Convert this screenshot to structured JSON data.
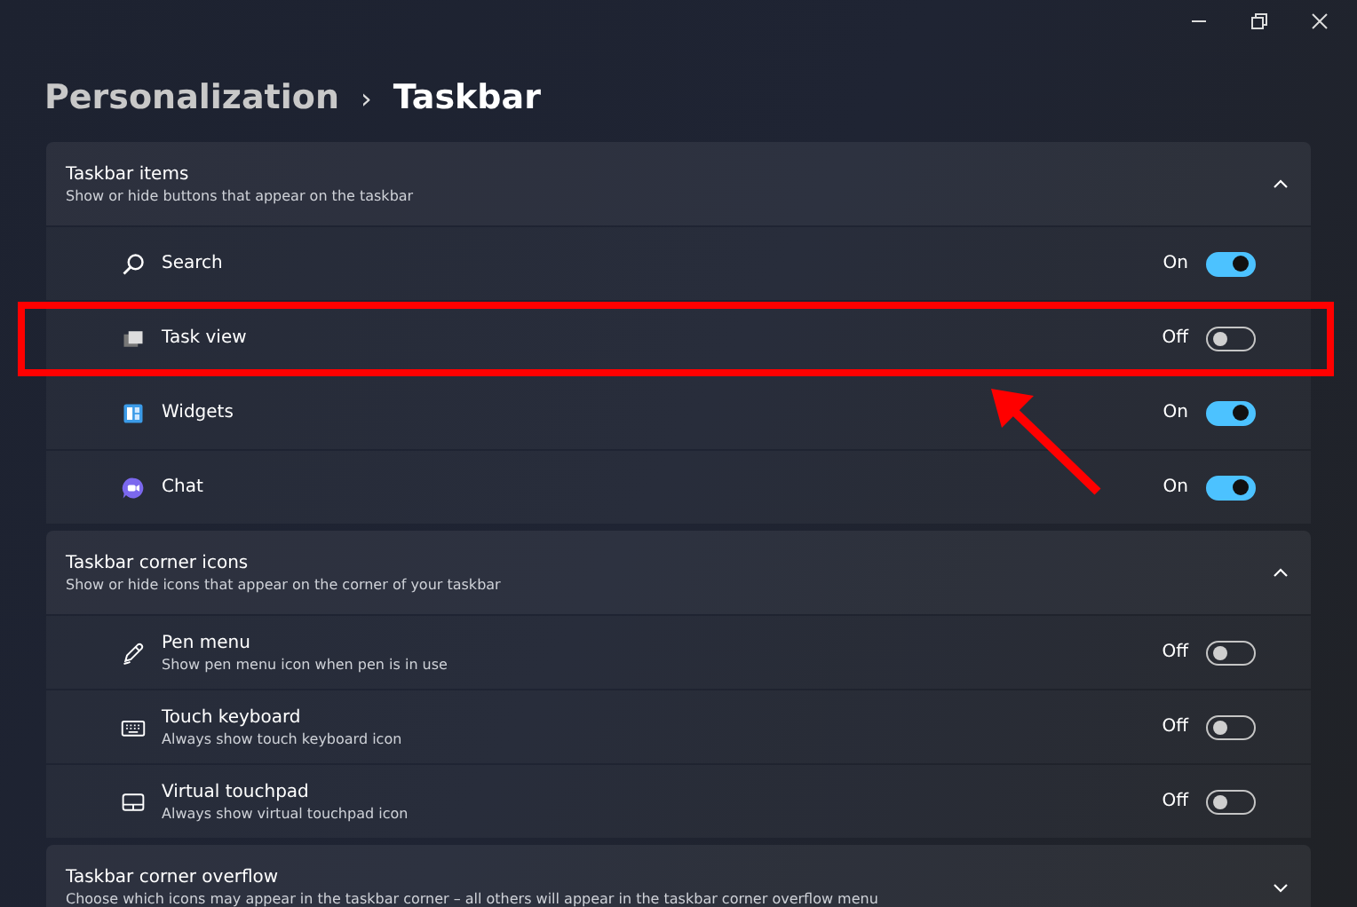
{
  "breadcrumb": {
    "parent": "Personalization",
    "separator": "›",
    "current": "Taskbar"
  },
  "sections": [
    {
      "title": "Taskbar items",
      "subtitle": "Show or hide buttons that appear on the taskbar",
      "expanded": true,
      "items": [
        {
          "label": "Search",
          "kind": "search",
          "state": "On",
          "on": true
        },
        {
          "label": "Task view",
          "kind": "taskview",
          "state": "Off",
          "on": false,
          "highlighted": true
        },
        {
          "label": "Widgets",
          "kind": "widgets",
          "state": "On",
          "on": true
        },
        {
          "label": "Chat",
          "kind": "chat",
          "state": "On",
          "on": true
        }
      ]
    },
    {
      "title": "Taskbar corner icons",
      "subtitle": "Show or hide icons that appear on the corner of your taskbar",
      "expanded": true,
      "items": [
        {
          "label": "Pen menu",
          "description": "Show pen menu icon when pen is in use",
          "kind": "pen",
          "state": "Off",
          "on": false
        },
        {
          "label": "Touch keyboard",
          "description": "Always show touch keyboard icon",
          "kind": "keyboard",
          "state": "Off",
          "on": false
        },
        {
          "label": "Virtual touchpad",
          "description": "Always show virtual touchpad icon",
          "kind": "touchpad",
          "state": "Off",
          "on": false
        }
      ]
    },
    {
      "title": "Taskbar corner overflow",
      "subtitle": "Choose which icons may appear in the taskbar corner – all others will appear in the taskbar corner overflow menu",
      "expanded": false
    }
  ]
}
